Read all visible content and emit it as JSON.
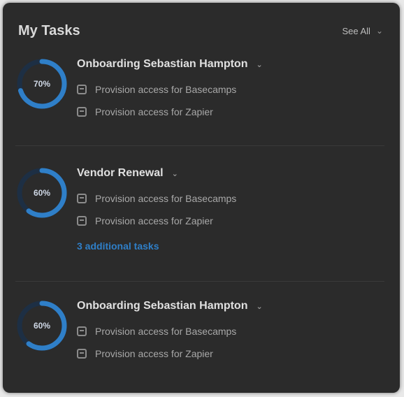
{
  "header": {
    "title": "My Tasks",
    "see_all_label": "See All",
    "see_all_icon": "chevron-down-icon"
  },
  "colors": {
    "card_bg": "#2b2b2b",
    "accent": "#2f7fc8",
    "ring_track": "#1d2f44"
  },
  "groups": [
    {
      "title": "Onboarding Sebastian Hampton",
      "progress_label": "70%",
      "progress": 0.7,
      "tasks": [
        {
          "label": "Provision access for Basecamps",
          "icon": "task-icon"
        },
        {
          "label": "Provision access for Zapier",
          "icon": "task-icon"
        }
      ],
      "more_link": ""
    },
    {
      "title": "Vendor Renewal",
      "progress_label": "60%",
      "progress": 0.6,
      "tasks": [
        {
          "label": "Provision access for Basecamps",
          "icon": "task-icon"
        },
        {
          "label": "Provision access for Zapier",
          "icon": "task-icon"
        }
      ],
      "more_link": "3 additional tasks"
    },
    {
      "title": "Onboarding Sebastian Hampton",
      "progress_label": "60%",
      "progress": 0.6,
      "tasks": [
        {
          "label": "Provision access for Basecamps",
          "icon": "task-icon"
        },
        {
          "label": "Provision access for Zapier",
          "icon": "task-icon"
        }
      ],
      "more_link": ""
    }
  ]
}
